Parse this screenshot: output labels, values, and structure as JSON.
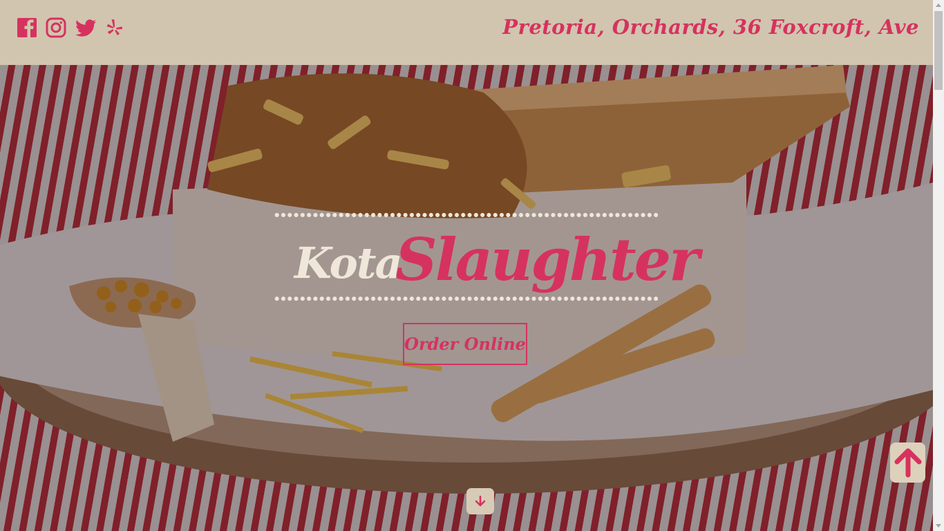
{
  "header": {
    "address": "Pretoria, Orchards, 36 Foxcroft, Ave",
    "social": [
      {
        "icon": "facebook-icon"
      },
      {
        "icon": "instagram-icon"
      },
      {
        "icon": "twitter-icon"
      },
      {
        "icon": "yelp-icon"
      }
    ]
  },
  "hero": {
    "title_part1": "Kota",
    "title_part2": "Slaughter",
    "order_button_label": "Order Online",
    "scroll_down_icon": "arrow-down-icon",
    "back_to_top_icon": "arrow-up-icon"
  },
  "colors": {
    "accent": "#d6325f",
    "header_bg": "#d1c5af",
    "cream": "#efe7da"
  }
}
